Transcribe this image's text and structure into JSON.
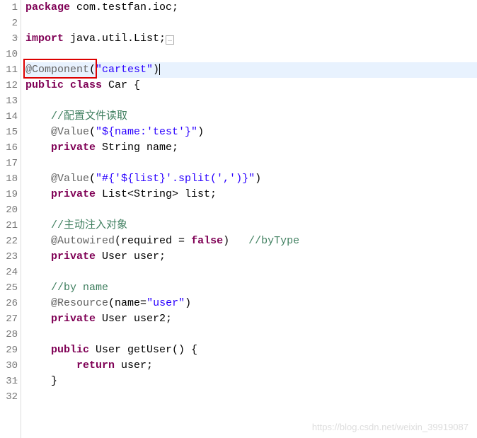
{
  "gutter": [
    "1",
    "2",
    "3",
    "10",
    "11",
    "12",
    "13",
    "14",
    "15",
    "16",
    "17",
    "18",
    "19",
    "20",
    "21",
    "22",
    "23",
    "24",
    "25",
    "26",
    "27",
    "28",
    "29",
    "30",
    "31",
    "32"
  ],
  "foldMarkers": {
    "2": "+",
    "8": "-",
    "11": "-",
    "17": "-",
    "21": "-",
    "24": "-"
  },
  "lines": {
    "l0": {
      "kw1": "package",
      "txt": " com.testfan.ioc;"
    },
    "l1": "",
    "l2": {
      "kw1": "import",
      "txt": " java.util.List;"
    },
    "l3": "",
    "l4": {
      "ann": "@Component",
      "lp": "(",
      "str": "\"cartest\"",
      "rp": ")"
    },
    "l5": {
      "kw1": "public",
      "kw2": " class",
      "txt": " Car {"
    },
    "l6": "",
    "l7": {
      "cmt": "    //配置文件读取"
    },
    "l8": {
      "ann": "    @Value",
      "lp": "(",
      "str": "\"${name:'test'}\"",
      "rp": ")"
    },
    "l9": {
      "kw1": "    private",
      "txt": " String name;"
    },
    "l10": "",
    "l11": {
      "ann": "    @Value",
      "lp": "(",
      "str": "\"#{'${list}'.split(',')}\"",
      "rp": ")"
    },
    "l12": {
      "kw1": "    private",
      "txt": " List<String> list;"
    },
    "l13": "",
    "l14": {
      "cmt": "    //主动注入对象"
    },
    "l15": {
      "ann": "    @Autowired",
      "lp": "(",
      "txt": "required = ",
      "kw": "false",
      "rp": ")",
      "cmt": "   //byType"
    },
    "l16": {
      "kw1": "    private",
      "txt": " User user;"
    },
    "l17": "",
    "l18": {
      "cmt": "    //by name"
    },
    "l19": {
      "ann": "    @Resource",
      "lp": "(",
      "txt": "name=",
      "str": "\"user\"",
      "rp": ")"
    },
    "l20": {
      "kw1": "    private",
      "txt": " User user2;"
    },
    "l21": "",
    "l22": {
      "kw1": "    public",
      "txt": " User getUser() {"
    },
    "l23": {
      "kw1": "        return",
      "txt": " user;"
    },
    "l24": {
      "txt": "    }"
    },
    "l25": ""
  },
  "watermark": "https://blog.csdn.net/weixin_39919087"
}
